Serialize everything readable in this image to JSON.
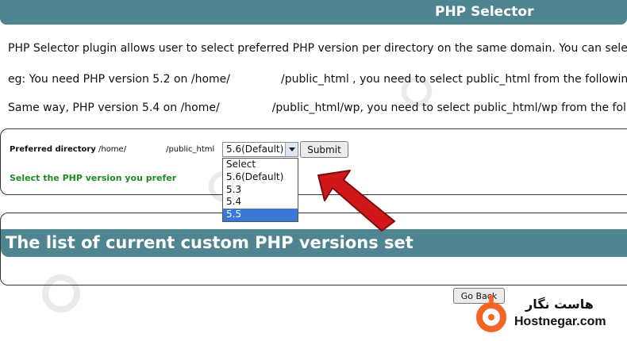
{
  "header": {
    "title": "PHP Selector"
  },
  "intro": {
    "line1": "PHP Selector plugin allows user to select preferred PHP version per directory on the same domain. You can select",
    "line2_a": "eg: You need PHP version 5.2 on /home/",
    "line2_b": "/public_html , you need to select public_html from the following",
    "line3_a": "Same way, PHP version 5.4 on /home/",
    "line3_b": "/public_html/wp, you need to select public_html/wp from the follo"
  },
  "form": {
    "label": "Preferred directory",
    "path_prefix": "/home/",
    "path_suffix": "/public_html",
    "selected_value": "5.6(Default)",
    "submit_label": "Submit",
    "hint": "Select the PHP version you prefer"
  },
  "dropdown": {
    "options": [
      "Select",
      "5.6(Default)",
      "5.3",
      "5.4",
      "5.5"
    ],
    "highlighted": "5.5"
  },
  "list_section": {
    "title": "The list of current custom PHP versions set"
  },
  "go_back_label": "Go Back",
  "brand": {
    "persian_name": "هاست نگار",
    "domain": "Hostnegar.com",
    "logo_color": "#f26522"
  },
  "colors": {
    "header_bg": "#4f8591",
    "hint_green": "#1f8a23",
    "arrow_red": "#d0181b",
    "highlight_blue": "#3a78d6"
  },
  "icons": {
    "dropdown": "chevron-down-icon",
    "pointer": "red-arrow-icon",
    "logo": "hostnegar-logo-icon"
  }
}
